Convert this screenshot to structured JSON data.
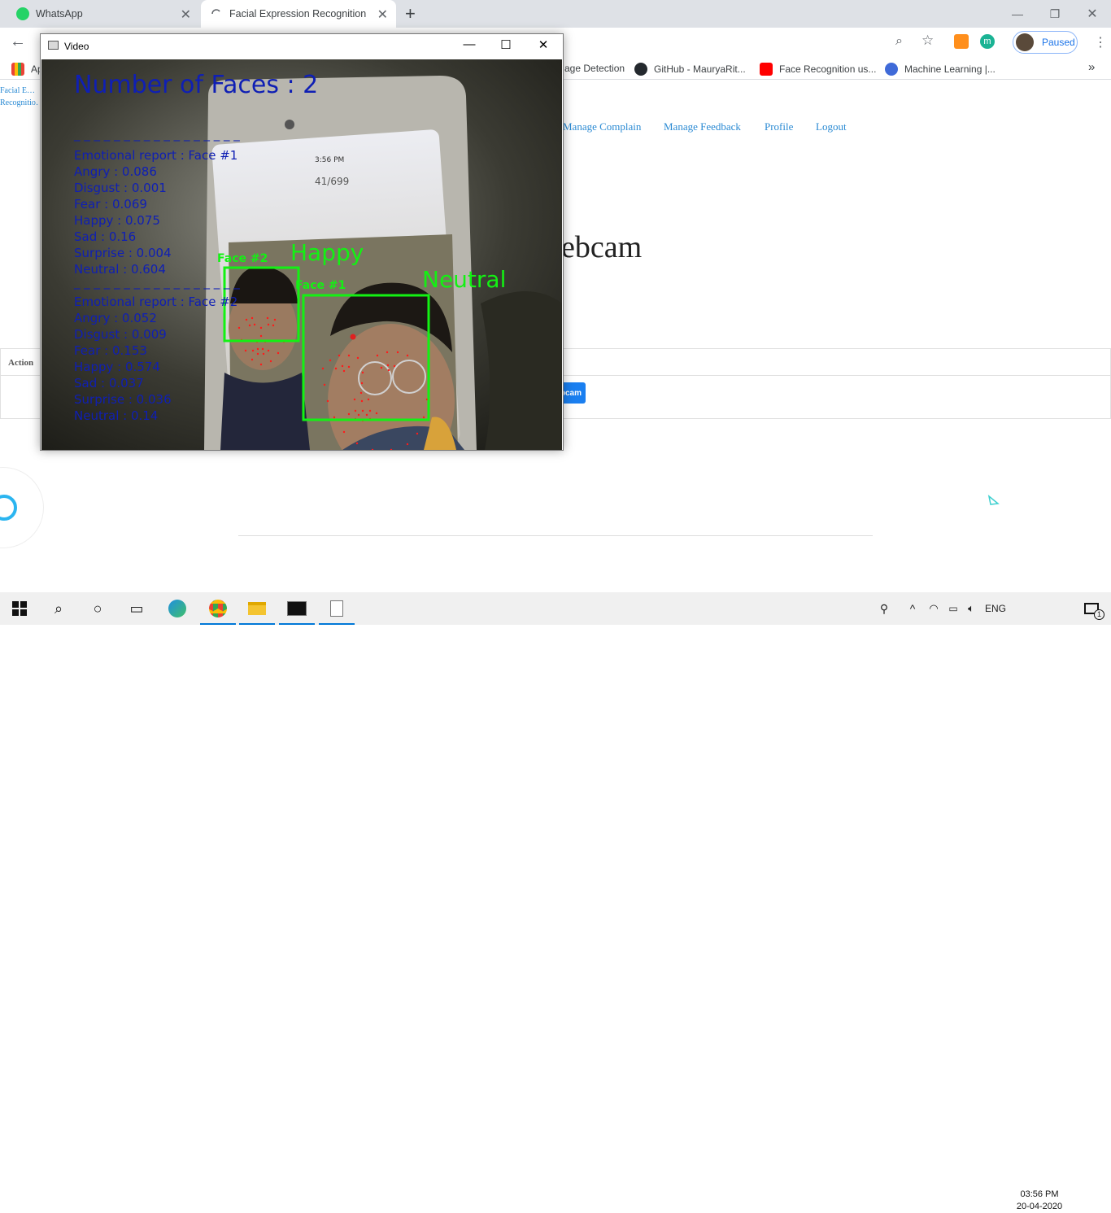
{
  "browser": {
    "tabs": [
      {
        "title": "WhatsApp",
        "active": false
      },
      {
        "title": "Facial Expression Recognition",
        "active": true
      }
    ],
    "profile_status": "Paused",
    "profile_initial": "m",
    "bookmarks": [
      {
        "label": "Ap"
      },
      {
        "label": "age Detection"
      },
      {
        "label": "GitHub - MauryaRit..."
      },
      {
        "label": "Face Recognition us..."
      },
      {
        "label": "Machine Learning |..."
      }
    ],
    "bookmark_overflow": "»"
  },
  "page": {
    "logo_alt": "Facial E… Recognitio…",
    "nav": [
      "Manage Complain",
      "Manage Feedback",
      "Profile",
      "Logout"
    ],
    "heading_fragment": "ebcam",
    "table_header": "Action",
    "webcam_button": "bcam"
  },
  "video_window": {
    "title": "Video",
    "overlay": {
      "faces_count": "Number of Faces : 2",
      "divider": "_ _ _ _ _ _ _ _ _ _ _ _ _ _ _ _ _",
      "report1": [
        "Emotional report : Face #1",
        "Angry : 0.086",
        "Disgust : 0.001",
        "Fear : 0.069",
        "Happy : 0.075",
        "Sad : 0.16",
        "Surprise : 0.004",
        "Neutral : 0.604"
      ],
      "report2": [
        "Emotional report : Face #2",
        "Angry : 0.052",
        "Disgust : 0.009",
        "Fear : 0.153",
        "Happy : 0.574",
        "Sad : 0.037",
        "Surprise : 0.036",
        "Neutral : 0.14"
      ],
      "face2_tag": "Face #2",
      "face2_emotion": "Happy",
      "face1_tag": "Face #1",
      "face1_emotion": "Neutral",
      "phone_time": "3:56 PM",
      "phone_counter": "41/699"
    }
  },
  "taskbar": {
    "language": "ENG",
    "time": "03:56 PM",
    "date": "20-04-2020",
    "notification_count": "1"
  },
  "colors": {
    "link_blue": "#2a8ad3",
    "overlay_text": "#0f1fb4",
    "face_box": "#13f113",
    "landmarks": "#ff1a1a",
    "accent": "#0078d7"
  }
}
